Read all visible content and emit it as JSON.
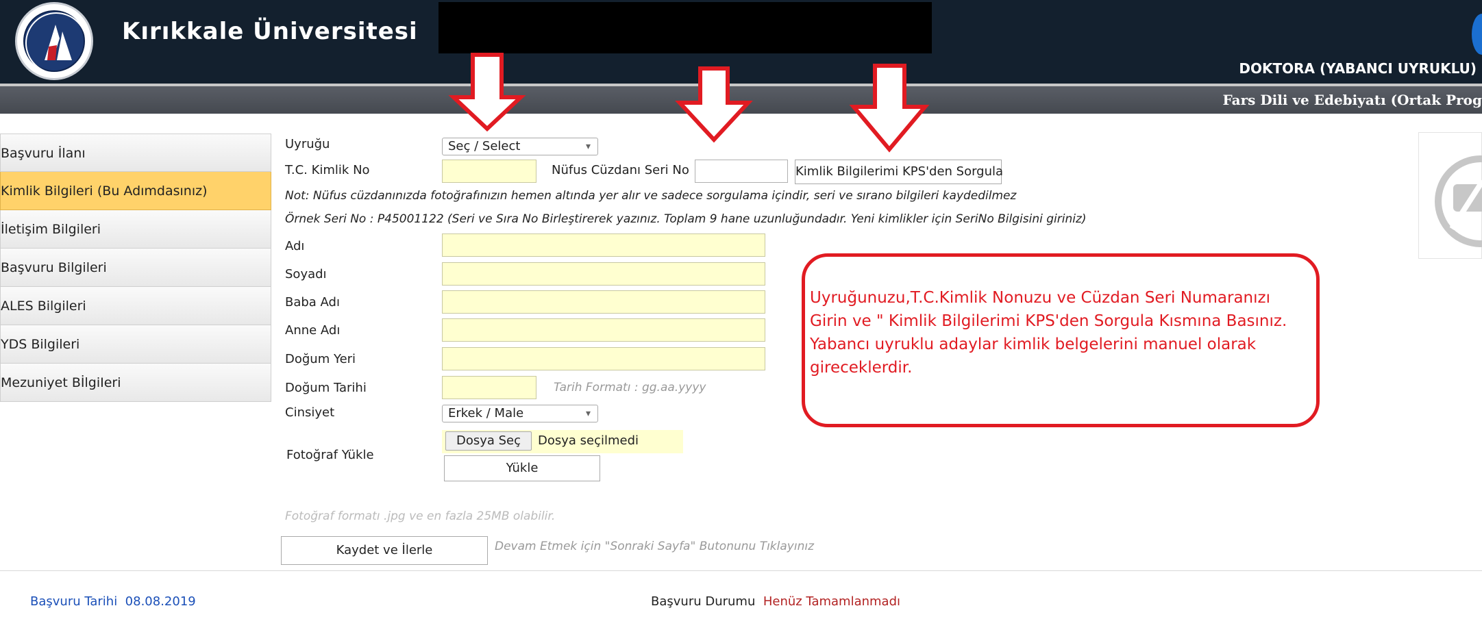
{
  "header": {
    "university": "Kırıkkale Üniversitesi",
    "program": "DOKTORA (YABANCI UYRUKLU)",
    "department": "Fars Dili ve Edebiyatı (Ortak Prog"
  },
  "sidebar": {
    "items": [
      {
        "label": "Başvuru İlanı"
      },
      {
        "label": "Kimlik Bilgileri (Bu Adımdasınız)"
      },
      {
        "label": "İletişim Bilgileri"
      },
      {
        "label": "Başvuru Bilgileri"
      },
      {
        "label": "ALES Bilgileri"
      },
      {
        "label": "YDS Bilgileri"
      },
      {
        "label": "Mezuniyet BİlgiIeri"
      }
    ],
    "active_index": 1
  },
  "form": {
    "nationality_label": "Uyruğu",
    "nationality_value": "Seç / Select",
    "tc_label": "T.C. Kimlik No",
    "tc_value": "",
    "serial_label": "Nüfus Cüzdanı Seri No",
    "serial_value": "",
    "kps_button": "Kimlik Bilgilerimi KPS'den Sorgula",
    "note1": "Not: Nüfus cüzdanınızda fotoğrafınızın hemen altında yer alır ve sadece sorgulama içindir, seri ve sırano bilgileri kaydedilmez",
    "note2": "Örnek Seri No : P45001122 (Seri ve Sıra No Birleştirerek yazınız. Toplam 9 hane uzunluğundadır. Yeni kimlikler için SeriNo Bilgisini giriniz)",
    "name_label": "Adı",
    "surname_label": "Soyadı",
    "father_label": "Baba Adı",
    "mother_label": "Anne Adı",
    "birthplace_label": "Doğum Yeri",
    "birthdate_label": "Doğum Tarihi",
    "date_hint": "Tarih Formatı : gg.aa.yyyy",
    "gender_label": "Cinsiyet",
    "gender_value": "Erkek / Male",
    "photo_label": "Fotoğraf Yükle",
    "choose_file": "Dosya Seç",
    "no_file": "Dosya seçilmedi",
    "upload_button": "Yükle",
    "photo_hint": "Fotoğraf formatı .jpg ve en fazla 25MB olabilir.",
    "save_button": "Kaydet ve İlerle",
    "save_hint": "Devam Etmek için \"Sonraki Sayfa\" Butonunu Tıklayınız"
  },
  "callout": {
    "text": "Uyruğunuzu,T.C.Kimlik Nonuzu ve Cüzdan Seri Numaranızı Girin ve \" Kimlik Bilgilerimi KPS'den Sorgula Kısmına Basınız. Yabancı uyruklu adaylar kimlik belgelerini manuel olarak gireceklerdir."
  },
  "footer": {
    "date_label": "Başvuru Tarihi",
    "date_value": "08.08.2019",
    "status_label": "Başvuru Durumu",
    "status_value": "Henüz Tamamlanmadı"
  },
  "colors": {
    "header_bg": "#13202e",
    "active_tab": "#ffd26a",
    "input_bg": "#ffffd0",
    "annotation_red": "#e11b22",
    "footer_blue": "#1a4fb8",
    "status_red": "#b22222"
  }
}
